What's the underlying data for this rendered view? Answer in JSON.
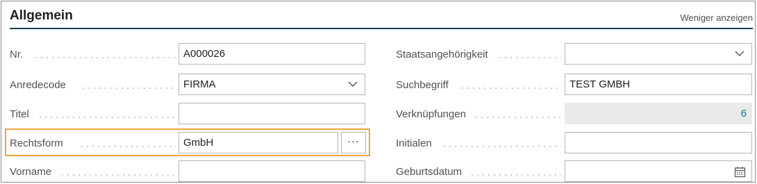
{
  "header": {
    "title": "Allgemein",
    "toggle_label": "Weniger anzeigen"
  },
  "left": {
    "nr": {
      "label": "Nr.",
      "value": "A000026"
    },
    "anredecode": {
      "label": "Anredecode",
      "value": "FIRMA"
    },
    "titel": {
      "label": "Titel",
      "value": ""
    },
    "rechtsform": {
      "label": "Rechtsform",
      "value": "GmbH",
      "lookup": "···"
    },
    "vorname": {
      "label": "Vorname",
      "value": ""
    }
  },
  "right": {
    "staatsangehoerigkeit": {
      "label": "Staatsangehörigkeit",
      "value": ""
    },
    "suchbegriff": {
      "label": "Suchbegriff",
      "value": "TEST GMBH"
    },
    "verknuepfungen": {
      "label": "Verknüpfungen",
      "value": "6"
    },
    "initialen": {
      "label": "Initialen",
      "value": ""
    },
    "geburtsdatum": {
      "label": "Geburtsdatum",
      "value": ""
    }
  },
  "colors": {
    "header_rule": "#1f3b57",
    "highlight": "#f0a33c",
    "link_value": "#1e6f8e"
  },
  "icons": {
    "dropdown": "chevron-down-icon",
    "calendar": "calendar-icon"
  }
}
